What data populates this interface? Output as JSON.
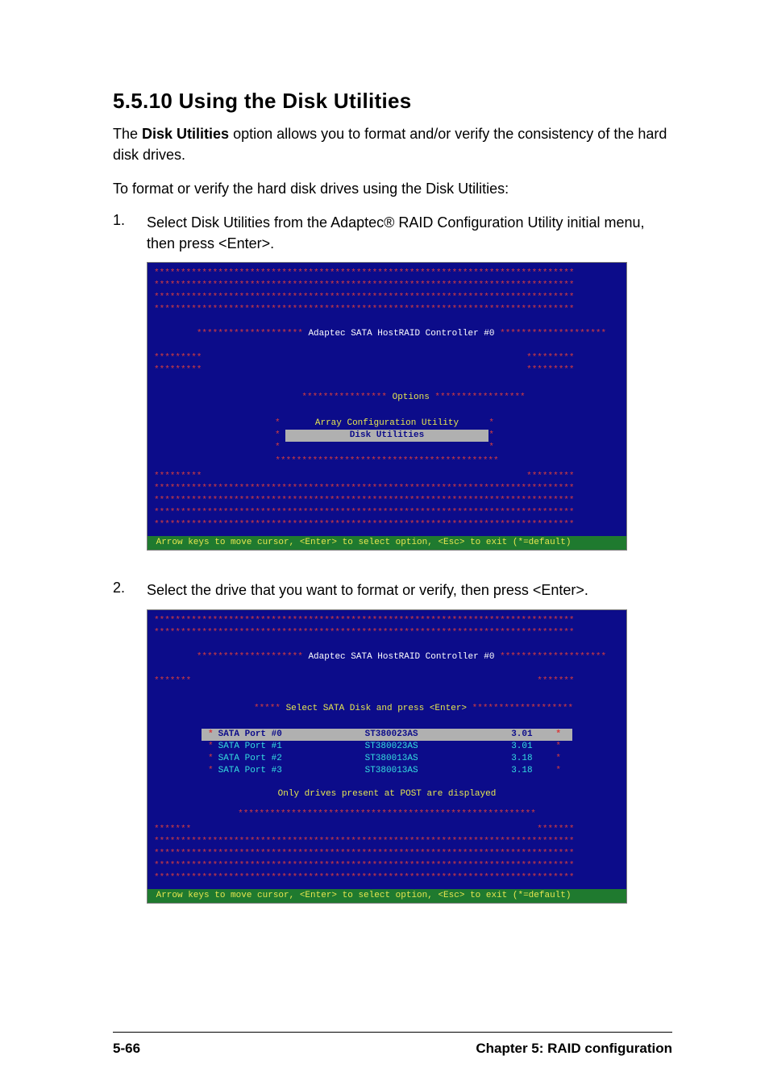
{
  "heading": "5.5.10 Using the Disk Utilities",
  "intro_prefix": "The ",
  "intro_bold": "Disk Utilities",
  "intro_suffix": " option allows you to format and/or verify the consistency of the hard disk drives.",
  "intro2": "To format or verify the hard disk drives using the Disk Utilities:",
  "steps": {
    "s1_num": "1.",
    "s1_text": "Select Disk Utilities from the Adaptec® RAID Configuration Utility initial menu, then press <Enter>.",
    "s2_num": "2.",
    "s2_text": "Select the drive that you want to format or verify, then press <Enter>."
  },
  "bios_common": {
    "controller_title": "Adaptec SATA HostRAID Controller #0",
    "footer_hint": " Arrow keys to move cursor, <Enter> to select option, <Esc> to exit (*=default)"
  },
  "shot1": {
    "options_title": " Options ",
    "menu": {
      "item1": "Array Configuration Utility",
      "item2": "Disk Utilities"
    }
  },
  "shot2": {
    "select_title": " Select SATA Disk and press <Enter> ",
    "rows": [
      {
        "port": "SATA Port #0",
        "model": "ST380023AS",
        "rev": "3.01"
      },
      {
        "port": "SATA Port #1",
        "model": "ST380023AS",
        "rev": "3.01"
      },
      {
        "port": "SATA Port #2",
        "model": "ST380013AS",
        "rev": "3.18"
      },
      {
        "port": "SATA Port #3",
        "model": "ST380013AS",
        "rev": "3.18"
      }
    ],
    "note": "Only drives present at POST are displayed"
  },
  "footer": {
    "left": "5-66",
    "right": "Chapter 5: RAID configuration"
  },
  "deco": {
    "long_stars": "*******************************************************************************",
    "side_stars": "*********",
    "side7": "*******",
    "mid_stars_options": "**************** Options *****************",
    "mid_border": "******************************************",
    "ctrl_line_stars_l": "********************",
    "ctrl_line_stars_r": "********************",
    "sel_hdr_l": "*****",
    "sel_hdr_r": "*******************",
    "drv_border": "********************************************************"
  }
}
